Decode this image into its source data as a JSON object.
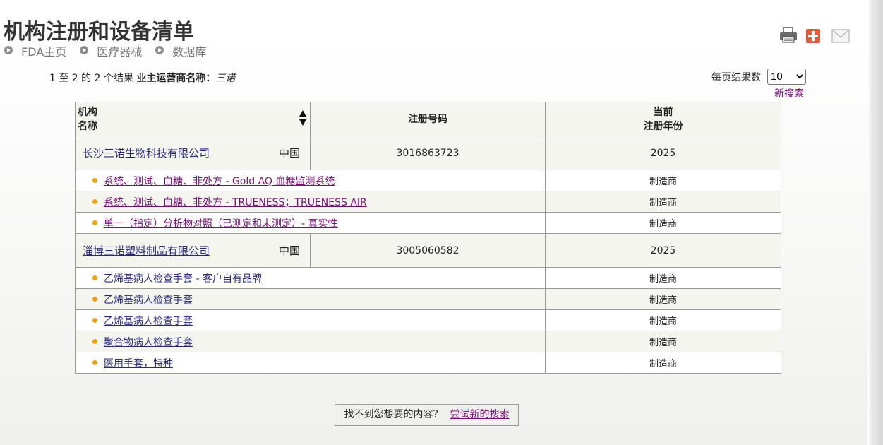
{
  "page": {
    "title": "机构注册和设备清单"
  },
  "breadcrumb": [
    "FDA主页",
    "医疗器械",
    "数据库"
  ],
  "tools": {
    "icons": [
      "print-icon",
      "plus-icon",
      "mail-icon"
    ]
  },
  "summary": {
    "range_text": "1 至 2 的 2 个结果",
    "filter_label": "业主运营商名称：",
    "filter_value": "三诺"
  },
  "per_page": {
    "label": "每页结果数",
    "selected": "10"
  },
  "new_search_label": "新搜索",
  "table": {
    "headers": {
      "name_line1": "机构",
      "name_line2": "名称",
      "reg": "注册号码",
      "year_line1": "当前",
      "year_line2": "注册年份"
    },
    "organizations": [
      {
        "name": "长沙三诺生物科技有限公司",
        "country": "中国",
        "reg_number": "3016863723",
        "year": "2025",
        "devices": [
          {
            "name": "系统、测试、血糖、非处方 - Gold AQ 血糖监测系统",
            "role": "制造商",
            "visited": true
          },
          {
            "name": "系统、测试、血糖、非处方 - TRUENESS；TRUENESS AIR",
            "role": "制造商",
            "visited": true
          },
          {
            "name": "单一（指定）分析物对照（已测定和未测定）- 真实性",
            "role": "制造商",
            "visited": true
          }
        ]
      },
      {
        "name": "淄博三诺塑料制品有限公司",
        "country": "中国",
        "reg_number": "3005060582",
        "year": "2025",
        "devices": [
          {
            "name": "乙烯基病人检查手套 - 客户自有品牌",
            "role": "制造商",
            "visited": false
          },
          {
            "name": "乙烯基病人检查手套",
            "role": "制造商",
            "visited": false
          },
          {
            "name": "乙烯基病人检查手套",
            "role": "制造商",
            "visited": false
          },
          {
            "name": "聚合物病人检查手套",
            "role": "制造商",
            "visited": false
          },
          {
            "name": "医用手套，特种",
            "role": "制造商",
            "visited": false
          }
        ]
      }
    ]
  },
  "not_found": {
    "text": "找不到您想要的内容？",
    "link": "尝试新的搜索"
  },
  "colors": {
    "link_visited": "#7a0d7a",
    "link_unvisited": "#2a2a7a",
    "bullet": "#f0a018",
    "row_alt": "#f5f5ef"
  }
}
